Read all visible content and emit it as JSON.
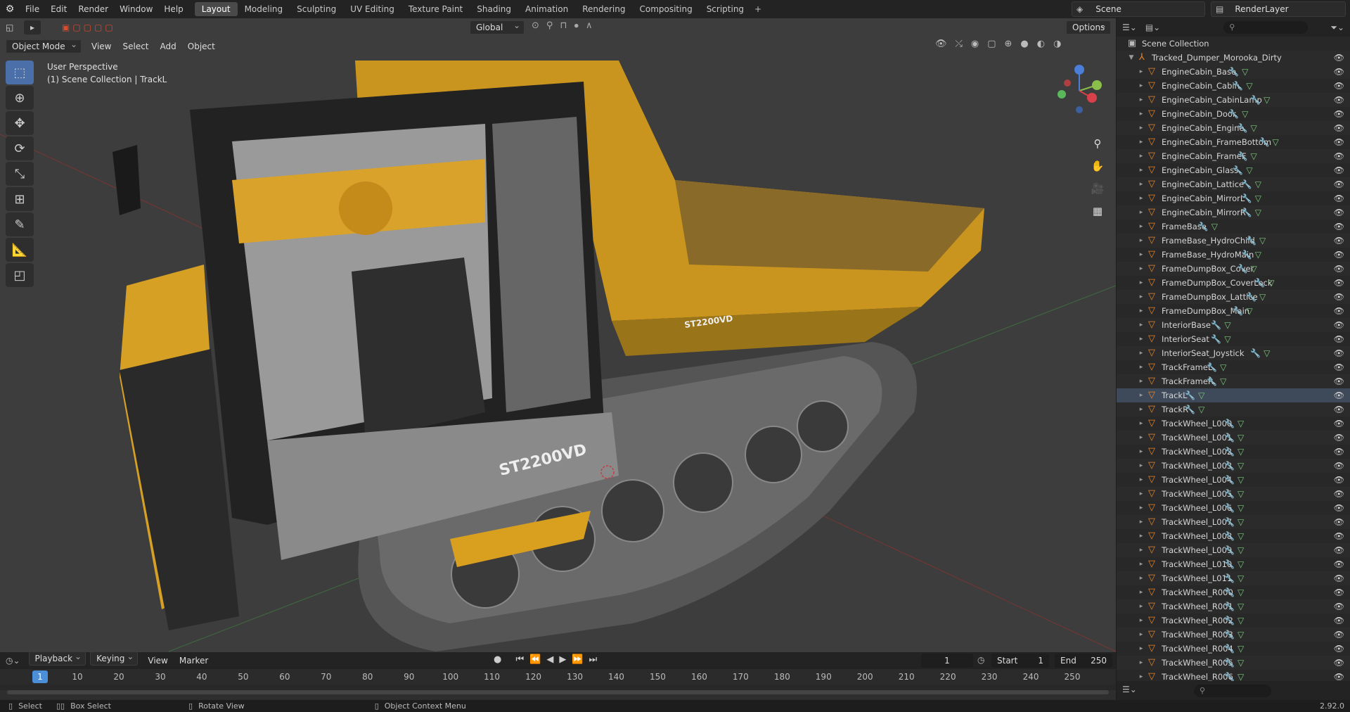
{
  "menu": [
    "File",
    "Edit",
    "Render",
    "Window",
    "Help"
  ],
  "workspaces": [
    {
      "label": "Layout",
      "active": true
    },
    {
      "label": "Modeling"
    },
    {
      "label": "Sculpting"
    },
    {
      "label": "UV Editing"
    },
    {
      "label": "Texture Paint"
    },
    {
      "label": "Shading"
    },
    {
      "label": "Animation"
    },
    {
      "label": "Rendering"
    },
    {
      "label": "Compositing"
    },
    {
      "label": "Scripting"
    }
  ],
  "scene": {
    "name": "Scene",
    "render_layer": "RenderLayer"
  },
  "viewport": {
    "mode": "Object Mode",
    "menus": [
      "View",
      "Select",
      "Add",
      "Object"
    ],
    "transform_orientation": "Global",
    "options_label": "Options",
    "info_line1": "User Perspective",
    "info_line2": "(1) Scene Collection | TrackL",
    "vehicle_label": "ST2200VD",
    "vehicle_label2": "ST2200VD"
  },
  "outliner": {
    "root": "Scene Collection",
    "collection": "Tracked_Dumper_Morooka_Dirty",
    "selected": "TrackL",
    "items": [
      "EngineCabin_Base",
      "EngineCabin_Cabin",
      "EngineCabin_CabinLamp",
      "EngineCabin_Door",
      "EngineCabin_Engine",
      "EngineCabin_FrameBottom",
      "EngineCabin_FrameF",
      "EngineCabin_Glass",
      "EngineCabin_Lattice",
      "EngineCabin_MirrorL",
      "EngineCabin_MirrorR",
      "FrameBase",
      "FrameBase_HydroChild",
      "FrameBase_HydroMain",
      "FrameDumpBox_Cover",
      "FrameDumpBox_CoverLock",
      "FrameDumpBox_Lattice",
      "FrameDumpBox_Main",
      "InteriorBase",
      "InteriorSeat",
      "InteriorSeat_Joystick",
      "TrackFrameL",
      "TrackFrameR",
      "TrackL",
      "TrackR",
      "TrackWheel_L000",
      "TrackWheel_L001",
      "TrackWheel_L002",
      "TrackWheel_L003",
      "TrackWheel_L004",
      "TrackWheel_L005",
      "TrackWheel_L006",
      "TrackWheel_L007",
      "TrackWheel_L008",
      "TrackWheel_L009",
      "TrackWheel_L010",
      "TrackWheel_L011",
      "TrackWheel_R000",
      "TrackWheel_R001",
      "TrackWheel_R002",
      "TrackWheel_R003",
      "TrackWheel_R004",
      "TrackWheel_R005",
      "TrackWheel_R006"
    ]
  },
  "timeline": {
    "menus": [
      "Playback",
      "Keying",
      "View",
      "Marker"
    ],
    "current_frame": "1",
    "start_label": "Start",
    "start": "1",
    "end_label": "End",
    "end": "250",
    "ticks": [
      "1",
      "10",
      "20",
      "30",
      "40",
      "50",
      "60",
      "70",
      "80",
      "90",
      "100",
      "110",
      "120",
      "130",
      "140",
      "150",
      "160",
      "170",
      "180",
      "190",
      "200",
      "210",
      "220",
      "230",
      "240",
      "250"
    ]
  },
  "status": {
    "select": "Select",
    "box_select": "Box Select",
    "rotate": "Rotate View",
    "context": "Object Context Menu",
    "version": "2.92.0"
  },
  "colors": {
    "accent": "#4a8fd8",
    "object_icon": "#e8842a",
    "yellow_body": "#e0a020"
  }
}
